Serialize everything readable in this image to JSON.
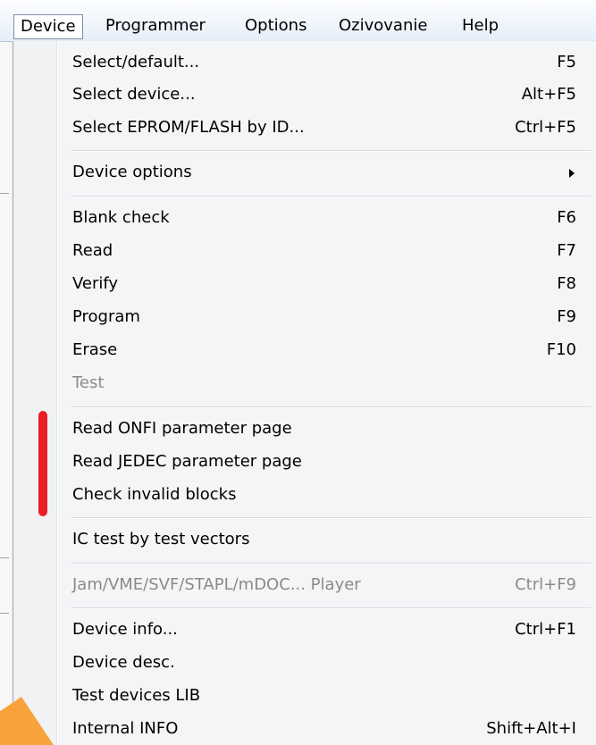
{
  "menubar": {
    "items": [
      "Device",
      "Programmer",
      "Options",
      "Ozivovanie",
      "Help"
    ]
  },
  "device_menu": {
    "groups": [
      [
        {
          "label": "Select/default...",
          "shortcut": "F5"
        },
        {
          "label": "Select device...",
          "shortcut": "Alt+F5"
        },
        {
          "label": "Select EPROM/FLASH by ID...",
          "shortcut": "Ctrl+F5"
        }
      ],
      [
        {
          "label": "Device options",
          "shortcut": ""
        }
      ],
      [
        {
          "label": "Blank check",
          "shortcut": "F6"
        },
        {
          "label": "Read",
          "shortcut": "F7"
        },
        {
          "label": "Verify",
          "shortcut": "F8"
        },
        {
          "label": "Program",
          "shortcut": "F9"
        },
        {
          "label": "Erase",
          "shortcut": "F10"
        },
        {
          "label": "Test",
          "shortcut": ""
        }
      ],
      [
        {
          "label": "Read ONFI parameter page",
          "shortcut": ""
        },
        {
          "label": "Read JEDEC parameter page",
          "shortcut": ""
        },
        {
          "label": "Check invalid blocks",
          "shortcut": ""
        }
      ],
      [
        {
          "label": "IC test by test vectors",
          "shortcut": ""
        }
      ],
      [
        {
          "label": "Jam/VME/SVF/STAPL/mDOC... Player",
          "shortcut": "Ctrl+F9"
        }
      ],
      [
        {
          "label": "Device info...",
          "shortcut": "Ctrl+F1"
        },
        {
          "label": "Device desc.",
          "shortcut": ""
        },
        {
          "label": "Test devices LIB",
          "shortcut": ""
        },
        {
          "label": "Internal INFO",
          "shortcut": "Shift+Alt+I"
        }
      ]
    ]
  },
  "colors": {
    "highlight_marker": "#ee1c24",
    "watermark": "#f7a23b",
    "disabled_text": "#8a8a8a"
  }
}
